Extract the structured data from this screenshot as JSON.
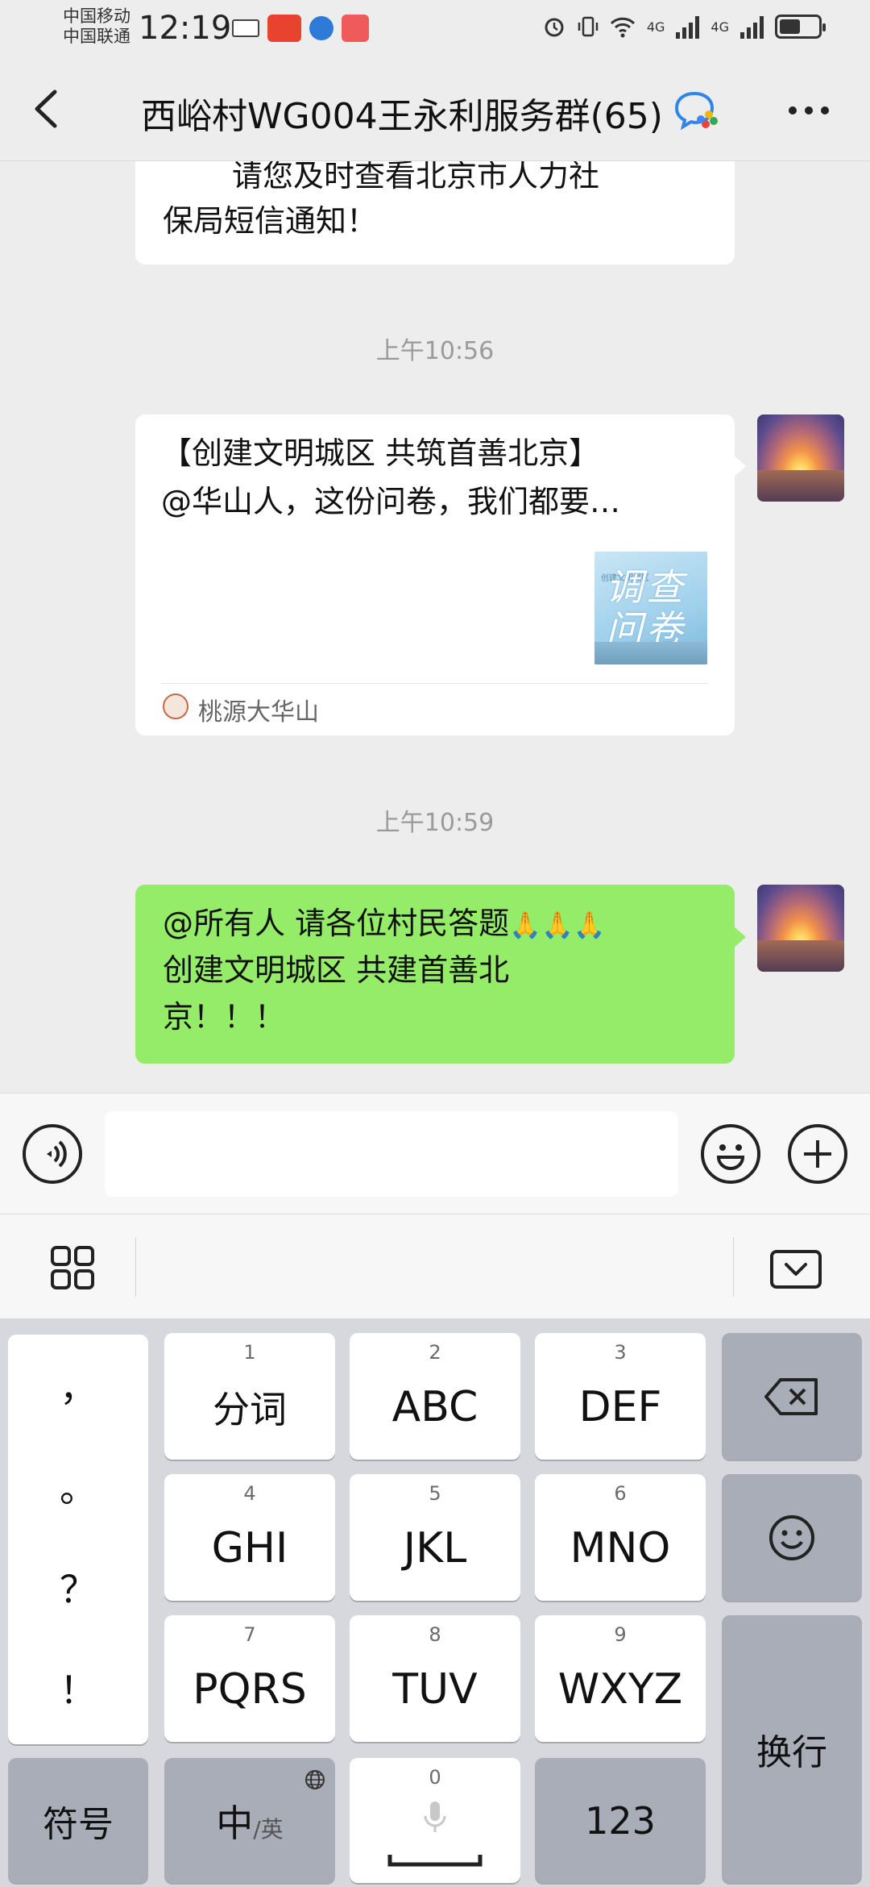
{
  "status_bar": {
    "carrier_1": "中国移动",
    "carrier_2": "中国联通",
    "time": "12:19",
    "net_label_1": "4G",
    "net_label_2": "4G"
  },
  "header": {
    "title": "西峪村WG004王永利服务群(65)"
  },
  "chat": {
    "partial_message_line1": "请您及时查看北京市人力社",
    "partial_message_line2": "保局短信通知！",
    "timestamp_1": "上午10:56",
    "card": {
      "title_line1": "【创建文明城区 共筑首善北京】",
      "title_line2": "@华山人，这份问卷，我们都要…",
      "thumb_small_text": "创建文明城区",
      "thumb_text": "调查问卷",
      "source": "桃源大华山"
    },
    "timestamp_2": "上午10:59",
    "green_message_line1": "@所有人  请各位村民答题",
    "green_message_emoji": "🙏🙏🙏",
    "green_message_line2": "创建文明城区  共建首善北",
    "green_message_line3": "京！！！"
  },
  "input": {
    "placeholder": ""
  },
  "keyboard": {
    "punctuation": [
      "，",
      "。",
      "？",
      "！"
    ],
    "keys": [
      {
        "num": "1",
        "label": "分词"
      },
      {
        "num": "2",
        "label": "ABC"
      },
      {
        "num": "3",
        "label": "DEF"
      },
      {
        "num": "4",
        "label": "GHI"
      },
      {
        "num": "5",
        "label": "JKL"
      },
      {
        "num": "6",
        "label": "MNO"
      },
      {
        "num": "7",
        "label": "PQRS"
      },
      {
        "num": "8",
        "label": "TUV"
      },
      {
        "num": "9",
        "label": "WXYZ"
      }
    ],
    "symbols_label": "符号",
    "lang_main": "中",
    "lang_alt": "/英",
    "space_num": "0",
    "num_label": "123",
    "enter_label": "换行"
  },
  "icons": {
    "back": "chevron-left-icon",
    "more": "ellipsis-icon",
    "voice": "voice-icon",
    "emoji": "smiley-icon",
    "plus": "plus-icon",
    "grid": "grid-icon",
    "collapse": "chevron-down-icon",
    "backspace": "backspace-icon",
    "emoji_key": "smiley-icon",
    "globe": "globe-icon",
    "mic": "mic-icon"
  },
  "colors": {
    "sent_bubble": "#95ec69",
    "received_bubble": "#ffffff",
    "background": "#ededed",
    "keyboard_bg": "#d6d8de"
  }
}
